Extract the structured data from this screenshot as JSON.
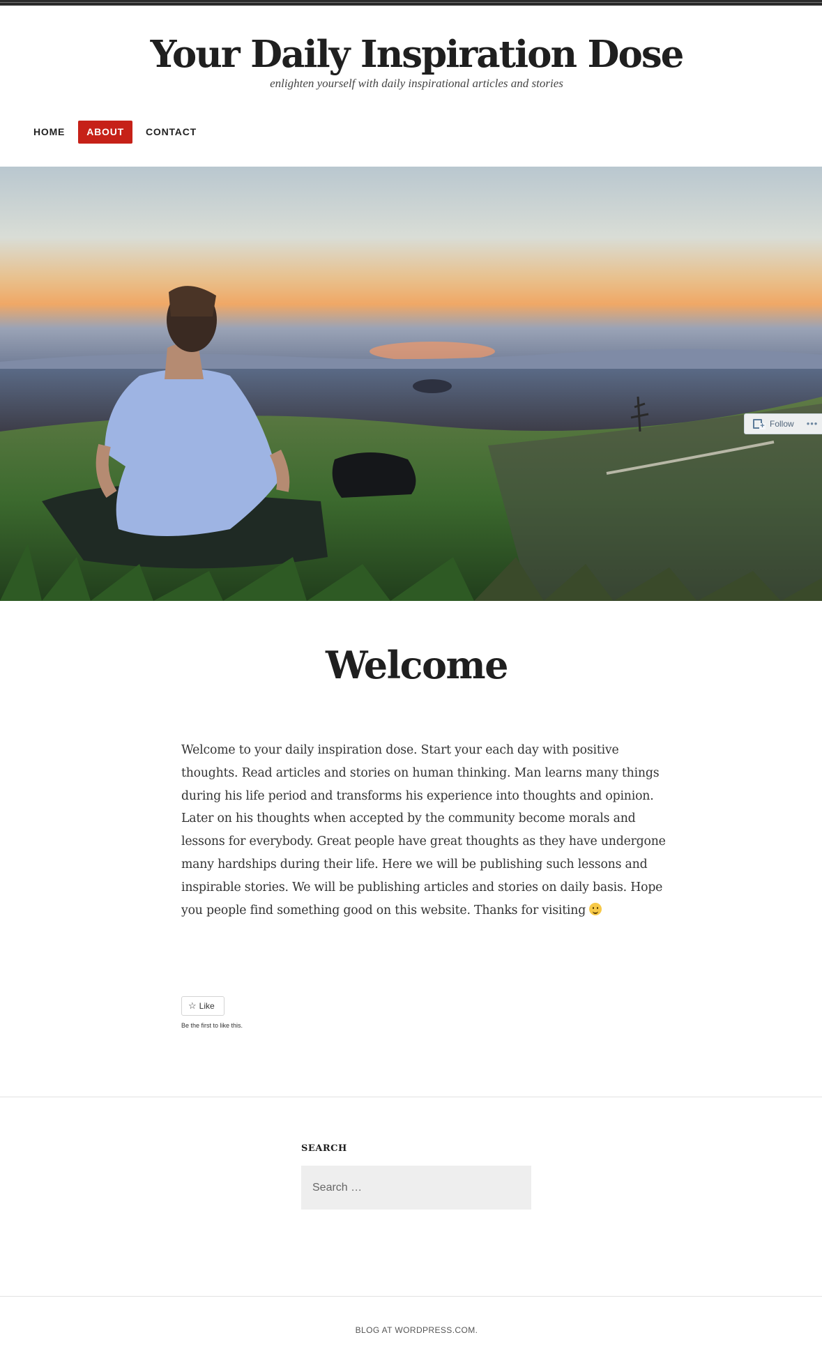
{
  "site": {
    "title": "Your Daily Inspiration Dose",
    "tagline": "enlighten yourself with daily inspirational articles and stories"
  },
  "nav": {
    "items": [
      {
        "label": "HOME",
        "active": false
      },
      {
        "label": "ABOUT",
        "active": true
      },
      {
        "label": "CONTACT",
        "active": false
      }
    ]
  },
  "hero": {
    "image_description_icon": "meditation-landscape-photo",
    "follow_label": "Follow",
    "more_label": "•••"
  },
  "entry": {
    "title": "Welcome",
    "body": "Welcome to your daily inspiration dose. Start your each day with positive thoughts. Read articles and stories on human thinking. Man learns many things during his life period and transforms his experience into thoughts and opinion. Later on his thoughts when accepted by the community become morals and lessons for everybody. Great people have great thoughts as they have undergone many hardships during their life. Here we will be publishing  such lessons and inspirable stories. We will be publishing articles and stories on daily basis. Hope you people find something good on this website. Thanks for visiting",
    "like_label": "Like",
    "like_note": "Be the first to like this."
  },
  "widget": {
    "title": "SEARCH",
    "search_placeholder": "Search …"
  },
  "footer": {
    "credit": "BLOG AT WORDPRESS.COM."
  },
  "colors": {
    "accent": "#c62118",
    "text": "#222222",
    "search_bg": "#eeeeee"
  }
}
